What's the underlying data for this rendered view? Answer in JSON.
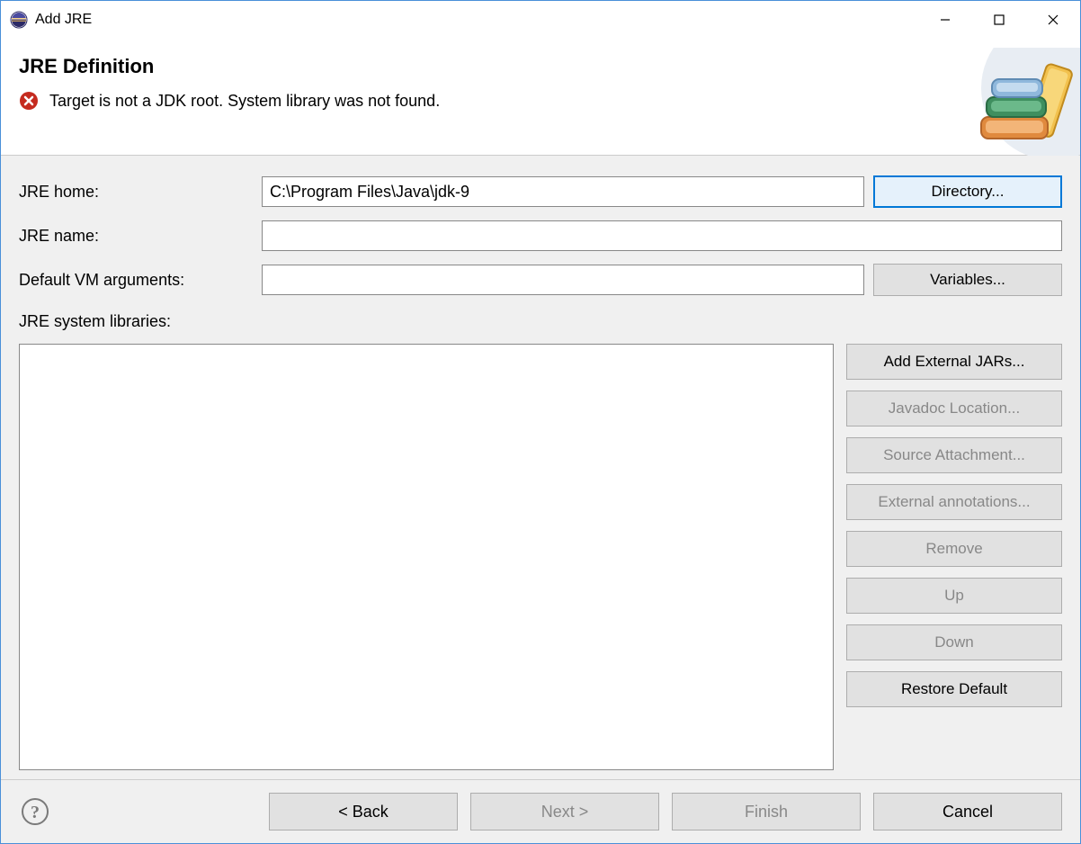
{
  "window": {
    "title": "Add JRE"
  },
  "banner": {
    "heading": "JRE Definition",
    "error_message": "Target is not a JDK root. System library was not found."
  },
  "form": {
    "jre_home_label": "JRE home:",
    "jre_home_value": "C:\\Program Files\\Java\\jdk-9",
    "directory_btn": "Directory...",
    "jre_name_label": "JRE name:",
    "jre_name_value": "",
    "vm_args_label": "Default VM arguments:",
    "vm_args_value": "",
    "variables_btn": "Variables...",
    "syslib_label": "JRE system libraries:"
  },
  "syslib_buttons": {
    "add_external": "Add External JARs...",
    "javadoc": "Javadoc Location...",
    "source": "Source Attachment...",
    "annotations": "External annotations...",
    "remove": "Remove",
    "up": "Up",
    "down": "Down",
    "restore": "Restore Default"
  },
  "footer": {
    "back": "< Back",
    "next": "Next >",
    "finish": "Finish",
    "cancel": "Cancel"
  }
}
